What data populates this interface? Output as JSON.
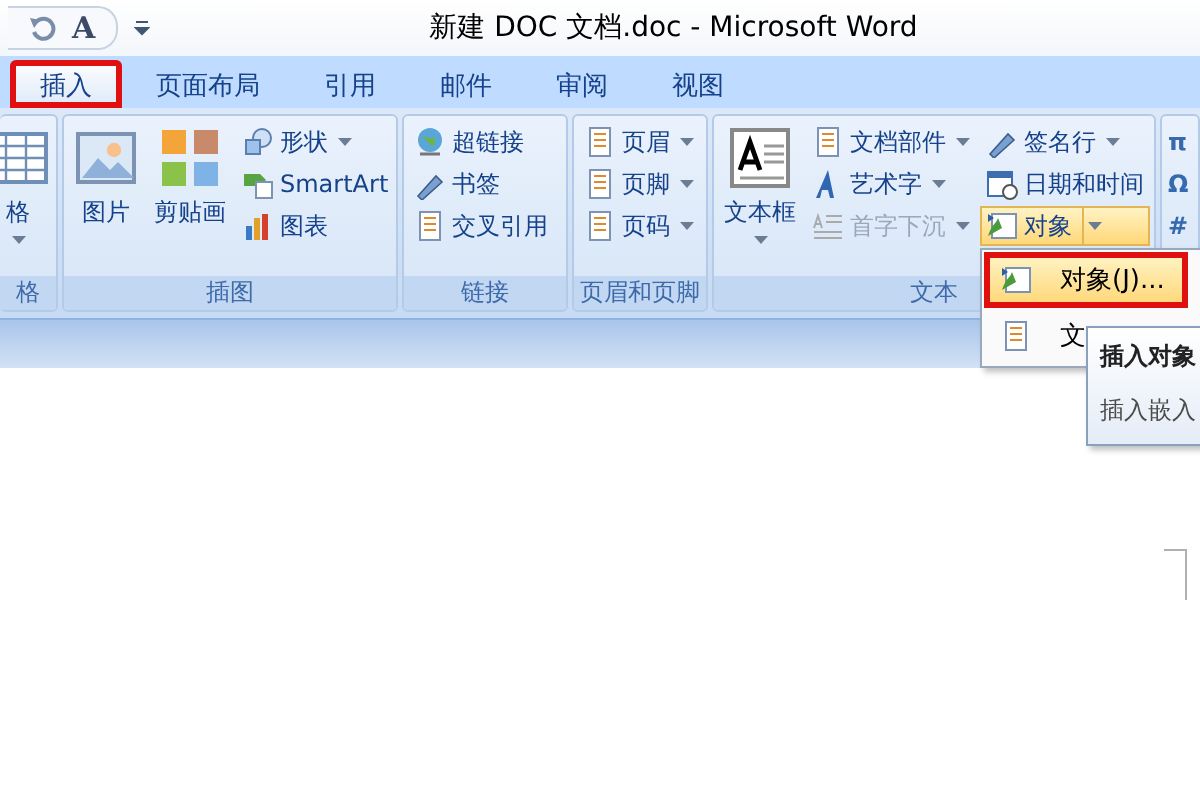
{
  "window": {
    "title": "新建 DOC 文档.doc - Microsoft Word"
  },
  "quick_access": {
    "font_glyph": "A"
  },
  "tabs": [
    {
      "label": "插入",
      "selected": true,
      "annotated": true
    },
    {
      "label": "页面布局",
      "selected": false,
      "annotated": false
    },
    {
      "label": "引用",
      "selected": false,
      "annotated": false
    },
    {
      "label": "邮件",
      "selected": false,
      "annotated": false
    },
    {
      "label": "审阅",
      "selected": false,
      "annotated": false
    },
    {
      "label": "视图",
      "selected": false,
      "annotated": false
    }
  ],
  "ribbon": {
    "groups": [
      {
        "label": "格",
        "columns": [
          {
            "kind": "large",
            "label": "格",
            "dropdown": true
          }
        ]
      },
      {
        "label": "插图",
        "columns": [
          {
            "kind": "large",
            "label": "图片",
            "dropdown": false
          },
          {
            "kind": "large",
            "label": "剪贴画",
            "dropdown": false
          },
          {
            "kind": "stack",
            "items": [
              {
                "label": "形状",
                "dropdown": true,
                "disabled": false,
                "expanded": false
              },
              {
                "label": "SmartArt",
                "dropdown": false,
                "disabled": false,
                "expanded": false
              },
              {
                "label": "图表",
                "dropdown": false,
                "disabled": false,
                "expanded": false
              }
            ]
          }
        ]
      },
      {
        "label": "链接",
        "columns": [
          {
            "kind": "stack",
            "items": [
              {
                "label": "超链接",
                "dropdown": false,
                "disabled": false,
                "expanded": false
              },
              {
                "label": "书签",
                "dropdown": false,
                "disabled": false,
                "expanded": false
              },
              {
                "label": "交叉引用",
                "dropdown": false,
                "disabled": false,
                "expanded": false
              }
            ]
          }
        ]
      },
      {
        "label": "页眉和页脚",
        "columns": [
          {
            "kind": "stack",
            "items": [
              {
                "label": "页眉",
                "dropdown": true,
                "disabled": false,
                "expanded": false
              },
              {
                "label": "页脚",
                "dropdown": true,
                "disabled": false,
                "expanded": false
              },
              {
                "label": "页码",
                "dropdown": true,
                "disabled": false,
                "expanded": false
              }
            ]
          }
        ]
      },
      {
        "label": "文本",
        "columns": [
          {
            "kind": "large",
            "label": "文本框",
            "dropdown": true
          },
          {
            "kind": "stack",
            "items": [
              {
                "label": "文档部件",
                "dropdown": true,
                "disabled": false,
                "expanded": false
              },
              {
                "label": "艺术字",
                "dropdown": true,
                "disabled": false,
                "expanded": false
              },
              {
                "label": "首字下沉",
                "dropdown": true,
                "disabled": true,
                "expanded": false
              }
            ]
          },
          {
            "kind": "stack",
            "items": [
              {
                "label": "签名行",
                "dropdown": true,
                "disabled": false,
                "expanded": false
              },
              {
                "label": "日期和时间",
                "dropdown": false,
                "disabled": false,
                "expanded": false
              },
              {
                "label": "对象",
                "dropdown": true,
                "disabled": false,
                "expanded": true
              }
            ]
          }
        ]
      },
      {
        "columns": [
          {
            "kind": "glyphs",
            "items": [
              "π",
              "Ω",
              "#"
            ]
          }
        ]
      }
    ]
  },
  "object_menu": {
    "items": [
      {
        "label": "对象(J)...",
        "selected": true,
        "annotated": true
      },
      {
        "label": "文",
        "selected": false,
        "annotated": false
      }
    ]
  },
  "tooltip": {
    "title": "插入对象",
    "body": "插入嵌入"
  }
}
